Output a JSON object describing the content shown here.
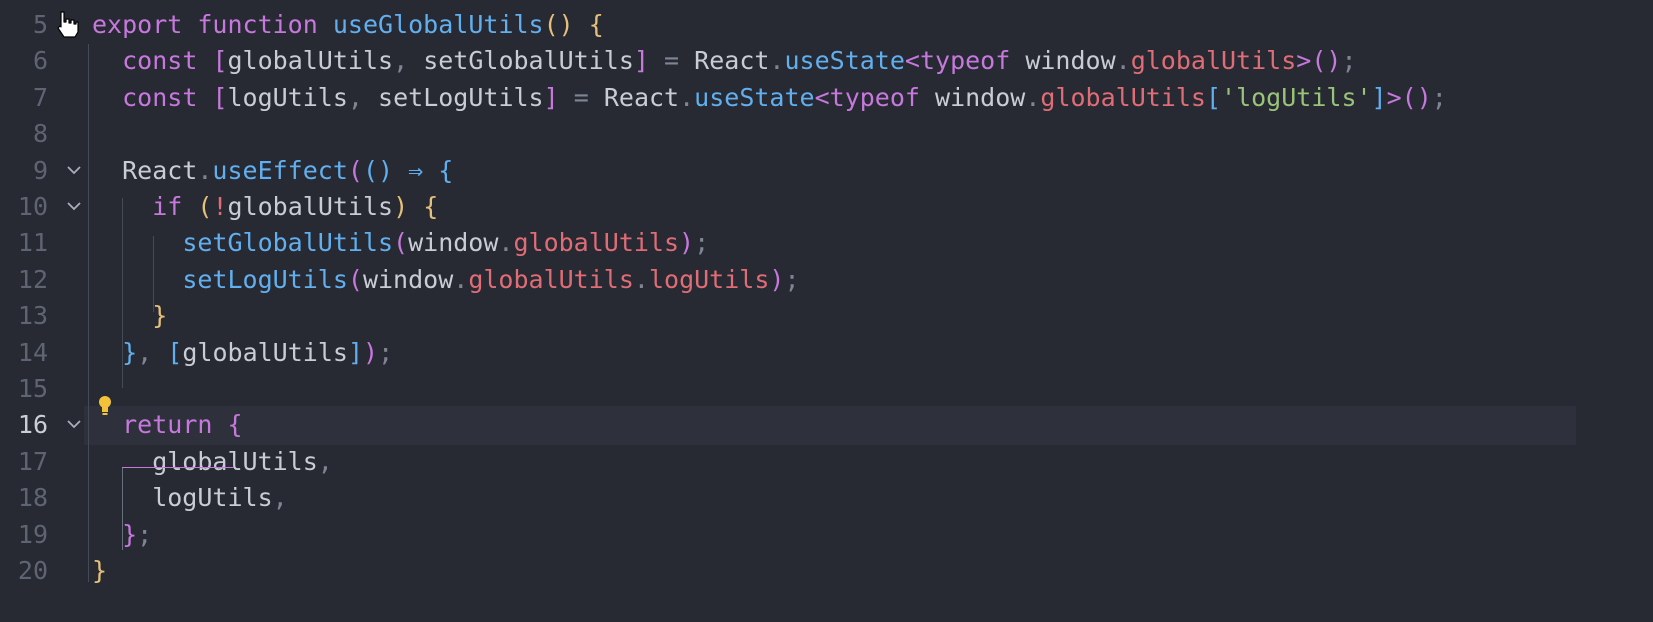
{
  "editor": {
    "active_line": "16",
    "lines": [
      {
        "n": "5",
        "fold": false,
        "code": [
          [
            "k",
            "export"
          ],
          [
            "t",
            " "
          ],
          [
            "k",
            "function"
          ],
          [
            "t",
            " "
          ],
          [
            "f",
            "useGlobalUtils"
          ],
          [
            "p",
            "()"
          ],
          [
            "t",
            " "
          ],
          [
            "p",
            "{"
          ]
        ]
      },
      {
        "n": "6",
        "fold": false,
        "code": [
          [
            "t",
            "  "
          ],
          [
            "k",
            "const"
          ],
          [
            "t",
            " "
          ],
          [
            "m",
            "["
          ],
          [
            "t",
            "globalUtils"
          ],
          [
            "d",
            ","
          ],
          [
            "t",
            " setGlobalUtils"
          ],
          [
            "m",
            "]"
          ],
          [
            "t",
            " "
          ],
          [
            "d",
            "="
          ],
          [
            "t",
            " React"
          ],
          [
            "d",
            "."
          ],
          [
            "f",
            "useState"
          ],
          [
            "k",
            "<"
          ],
          [
            "k",
            "typeof"
          ],
          [
            "t",
            " window"
          ],
          [
            "d",
            "."
          ],
          [
            "r",
            "globalUtils"
          ],
          [
            "k",
            ">"
          ],
          [
            "m",
            "()"
          ],
          [
            "d",
            ";"
          ]
        ]
      },
      {
        "n": "7",
        "fold": false,
        "code": [
          [
            "t",
            "  "
          ],
          [
            "k",
            "const"
          ],
          [
            "t",
            " "
          ],
          [
            "m",
            "["
          ],
          [
            "t",
            "logUtils"
          ],
          [
            "d",
            ","
          ],
          [
            "t",
            " setLogUtils"
          ],
          [
            "m",
            "]"
          ],
          [
            "t",
            " "
          ],
          [
            "d",
            "="
          ],
          [
            "t",
            " React"
          ],
          [
            "d",
            "."
          ],
          [
            "f",
            "useState"
          ],
          [
            "k",
            "<"
          ],
          [
            "k",
            "typeof"
          ],
          [
            "t",
            " window"
          ],
          [
            "d",
            "."
          ],
          [
            "r",
            "globalUtils"
          ],
          [
            "b",
            "["
          ],
          [
            "s",
            "'logUtils'"
          ],
          [
            "b",
            "]"
          ],
          [
            "k",
            ">"
          ],
          [
            "m",
            "()"
          ],
          [
            "d",
            ";"
          ]
        ]
      },
      {
        "n": "8",
        "fold": false,
        "code": []
      },
      {
        "n": "9",
        "fold": true,
        "code": [
          [
            "t",
            "  React"
          ],
          [
            "d",
            "."
          ],
          [
            "f",
            "useEffect"
          ],
          [
            "m",
            "("
          ],
          [
            "b",
            "()"
          ],
          [
            "t",
            " "
          ],
          [
            "f",
            "⇒"
          ],
          [
            "t",
            " "
          ],
          [
            "b",
            "{"
          ]
        ]
      },
      {
        "n": "10",
        "fold": true,
        "code": [
          [
            "t",
            "    "
          ],
          [
            "k",
            "if"
          ],
          [
            "t",
            " "
          ],
          [
            "p",
            "("
          ],
          [
            "r",
            "!"
          ],
          [
            "t",
            "globalUtils"
          ],
          [
            "p",
            ")"
          ],
          [
            "t",
            " "
          ],
          [
            "p",
            "{"
          ]
        ]
      },
      {
        "n": "11",
        "fold": false,
        "code": [
          [
            "t",
            "      "
          ],
          [
            "f",
            "setGlobalUtils"
          ],
          [
            "m",
            "("
          ],
          [
            "t",
            "window"
          ],
          [
            "d",
            "."
          ],
          [
            "r",
            "globalUtils"
          ],
          [
            "m",
            ")"
          ],
          [
            "d",
            ";"
          ]
        ]
      },
      {
        "n": "12",
        "fold": false,
        "code": [
          [
            "t",
            "      "
          ],
          [
            "f",
            "setLogUtils"
          ],
          [
            "m",
            "("
          ],
          [
            "t",
            "window"
          ],
          [
            "d",
            "."
          ],
          [
            "r",
            "globalUtils"
          ],
          [
            "d",
            "."
          ],
          [
            "r",
            "logUtils"
          ],
          [
            "m",
            ")"
          ],
          [
            "d",
            ";"
          ]
        ]
      },
      {
        "n": "13",
        "fold": false,
        "code": [
          [
            "t",
            "    "
          ],
          [
            "p",
            "}"
          ]
        ]
      },
      {
        "n": "14",
        "fold": false,
        "code": [
          [
            "t",
            "  "
          ],
          [
            "b",
            "}"
          ],
          [
            "d",
            ","
          ],
          [
            "t",
            " "
          ],
          [
            "b",
            "["
          ],
          [
            "t",
            "globalUtils"
          ],
          [
            "b",
            "]"
          ],
          [
            "m",
            ")"
          ],
          [
            "d",
            ";"
          ]
        ]
      },
      {
        "n": "15",
        "fold": false,
        "code": []
      },
      {
        "n": "16",
        "fold": true,
        "code": [
          [
            "t",
            "  "
          ],
          [
            "k",
            "return"
          ],
          [
            "t",
            " "
          ],
          [
            "m",
            "{"
          ]
        ]
      },
      {
        "n": "17",
        "fold": false,
        "code": [
          [
            "t",
            "    globalUtils"
          ],
          [
            "d",
            ","
          ]
        ]
      },
      {
        "n": "18",
        "fold": false,
        "code": [
          [
            "t",
            "    logUtils"
          ],
          [
            "d",
            ","
          ]
        ]
      },
      {
        "n": "19",
        "fold": false,
        "code": [
          [
            "t",
            "  "
          ],
          [
            "m",
            "}"
          ],
          [
            "d",
            ";"
          ]
        ]
      },
      {
        "n": "20",
        "fold": false,
        "code": [
          [
            "p",
            "}"
          ]
        ]
      }
    ]
  },
  "colors": {
    "background": "#272a33",
    "keyword": "#c678dd",
    "function": "#61afef",
    "property": "#e06c75",
    "string": "#98c379",
    "bracket_gold": "#e5c07b",
    "lightbulb": "#f2c23b"
  },
  "icons": {
    "fold": "chevron-down-icon",
    "hint": "lightbulb-icon",
    "pointer": "hand-cursor-icon"
  }
}
